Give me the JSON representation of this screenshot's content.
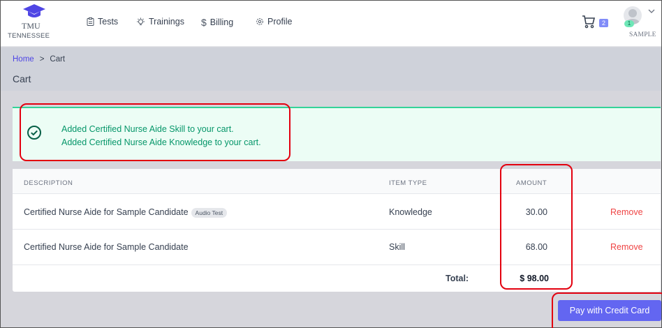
{
  "brand": {
    "line1": "TMU",
    "line2": "TENNESSEE"
  },
  "nav": [
    {
      "label": "Tests",
      "icon": "clipboard-icon"
    },
    {
      "label": "Trainings",
      "icon": "lightbulb-icon"
    },
    {
      "label": "Billing",
      "icon": "dollar-icon"
    },
    {
      "label": "Profile",
      "icon": "gear-icon"
    }
  ],
  "cart": {
    "count": "2"
  },
  "user": {
    "name": "SAMPLE",
    "badge": "1"
  },
  "breadcrumb": {
    "home": "Home",
    "separator": ">",
    "current": "Cart"
  },
  "page": {
    "title": "Cart"
  },
  "alert": {
    "lines": [
      "Added Certified Nurse Aide Skill to your cart.",
      "Added Certified Nurse Aide Knowledge to your cart."
    ],
    "color": "#059669"
  },
  "table": {
    "headers": {
      "description": "DESCRIPTION",
      "item_type": "ITEM TYPE",
      "amount": "AMOUNT"
    },
    "rows": [
      {
        "description": "Certified Nurse Aide for Sample Candidate",
        "tag": "Audio Test",
        "item_type": "Knowledge",
        "amount": "30.00",
        "action": "Remove"
      },
      {
        "description": "Certified Nurse Aide for Sample Candidate",
        "item_type": "Skill",
        "amount": "68.00",
        "action": "Remove"
      }
    ],
    "total_label": "Total:",
    "total_value": "$ 98.00"
  },
  "pay_button": {
    "label": "Pay with Credit Card",
    "color": "#6366f1"
  }
}
